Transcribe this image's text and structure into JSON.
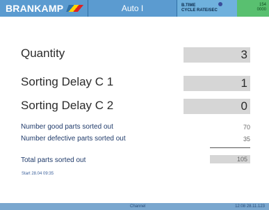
{
  "header": {
    "logo_text": "BRANKAMP",
    "mode_label": "Auto I",
    "status_label_1": "B.TIME",
    "status_label_2": "CYCLE RATE/SEC",
    "status_value_1": "154",
    "status_value_2": "0000"
  },
  "main": {
    "quantity_label": "Quantity",
    "quantity_value": "3",
    "delay1_label": "Sorting Delay C 1",
    "delay1_value": "1",
    "delay2_label": "Sorting Delay C 2",
    "delay2_value": "0",
    "good_label": "Number good parts sorted out",
    "good_value": "70",
    "defective_label": "Number defective parts sorted out",
    "defective_value": "35",
    "total_label": "Total parts sorted out",
    "total_value": "105",
    "start_text": "Start 28.04 09:35"
  },
  "footer": {
    "center_text": "Channel",
    "right_text": "12:08 28.11.123"
  },
  "colors": {
    "header_blue": "#5b9bd0",
    "status_green": "#59c070",
    "value_box_gray": "#d6d6d6",
    "footer_blue": "#7aa7cf"
  },
  "icons": {
    "logo_mark": "brankamp-logo-stripes",
    "status_indicator": "status-dot-icon"
  }
}
